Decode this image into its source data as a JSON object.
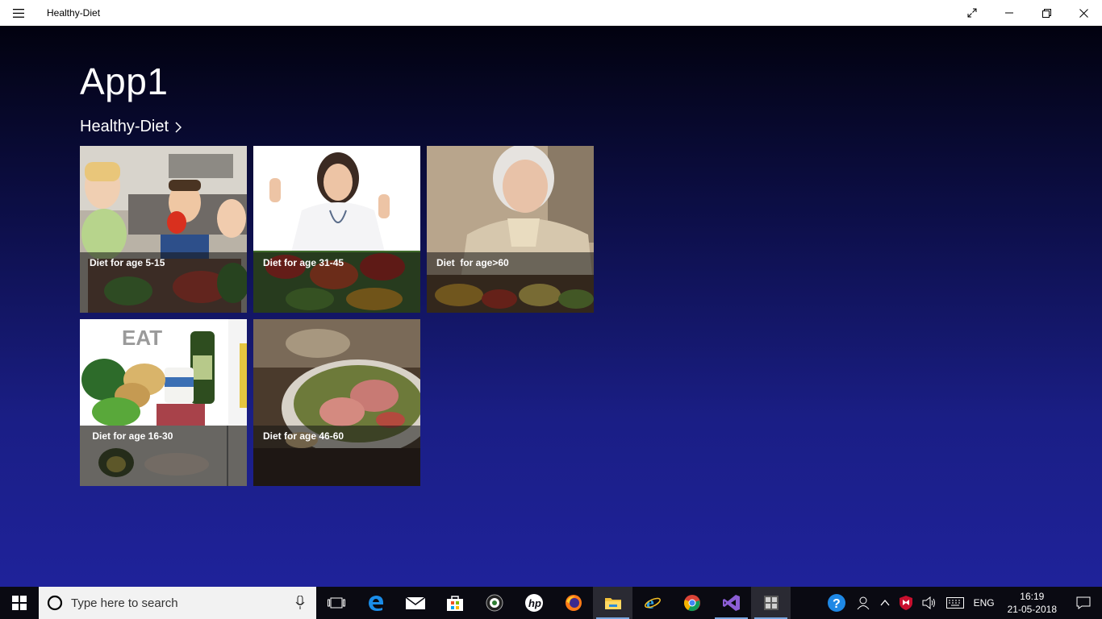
{
  "window": {
    "title": "Healthy-Diet"
  },
  "page": {
    "title": "App1",
    "section_header": "Healthy-Diet"
  },
  "tiles": [
    {
      "caption": "Diet for age 5-15"
    },
    {
      "caption": "Diet for age 31-45"
    },
    {
      "caption": "Diet  for age>60"
    },
    {
      "caption": " Diet for age 16-30"
    },
    {
      "caption": "Diet for age 46-60"
    }
  ],
  "taskbar": {
    "search_placeholder": "Type here to search",
    "language": "ENG",
    "time": "16:19",
    "date": "21-05-2018",
    "apps": [
      "task-view",
      "edge",
      "mail",
      "store",
      "camera",
      "hp",
      "firefox",
      "file-explorer",
      "internet-explorer",
      "chrome",
      "visual-studio",
      "healthy-diet"
    ]
  },
  "colors": {
    "background_top": "#02020f",
    "background_bottom": "#1f229a",
    "titlebar": "#ffffff",
    "taskbar": "#0a0a12"
  }
}
